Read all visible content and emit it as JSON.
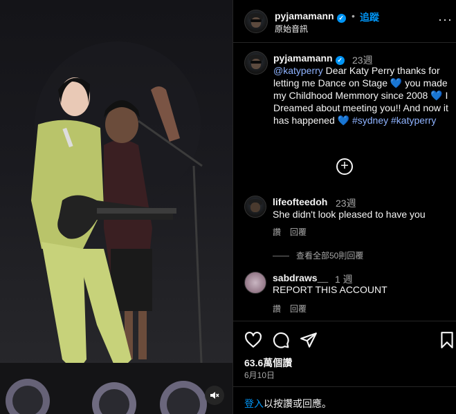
{
  "header": {
    "username": "pyjamamann",
    "dot": "•",
    "follow_label": "追蹤",
    "audio_label": "原始音訊",
    "more_label": "···"
  },
  "caption": {
    "username": "pyjamamann",
    "time": "23週",
    "mention": "@katyperry",
    "text_part1": " Dear Katy Perry thanks for letting me Dance on Stage ",
    "text_part2": " you made my Childhood Memmory since 2008 ",
    "text_part3": " I Dreamed about meeting you!! And now it has happened ",
    "hashtag1": "#sydney",
    "hashtag2": "#katyperry",
    "heart": "💙"
  },
  "comments": [
    {
      "username": "lifeofteedoh",
      "time": "23週",
      "text": "She didn't look pleased to have you",
      "like_label": "讚",
      "reply_label": "回覆"
    },
    {
      "username": "sabdraws__",
      "time": "1 週",
      "text": "REPORT THIS ACCOUNT",
      "like_label": "讚",
      "reply_label": "回覆"
    }
  ],
  "view_all_replies": "查看全部50則回覆",
  "actions": {
    "like_icon": "heart-outline-icon",
    "comment_icon": "comment-bubble-icon",
    "share_icon": "paper-plane-icon",
    "save_icon": "bookmark-icon"
  },
  "views": "63.6萬個讚",
  "date": "6月10日",
  "login": {
    "link": "登入",
    "rest": "以按讚或回應。"
  },
  "media": {
    "mute_icon": "speaker-muted-icon"
  },
  "colors": {
    "accent": "#0095f6",
    "background": "#000000",
    "secondary_text": "#a8a8a8",
    "heart_blue": "#2e8ef7"
  }
}
